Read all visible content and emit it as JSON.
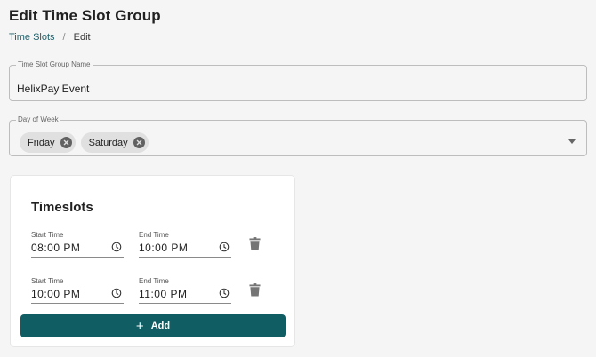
{
  "page": {
    "title": "Edit Time Slot Group"
  },
  "breadcrumb": {
    "link": "Time Slots",
    "separator": "/",
    "current": "Edit"
  },
  "group_name": {
    "label": "Time Slot Group Name",
    "value": "HelixPay Event"
  },
  "day_of_week": {
    "label": "Day of Week",
    "chips": [
      "Friday",
      "Saturday"
    ]
  },
  "timeslots": {
    "title": "Timeslots",
    "rows": [
      {
        "start_label": "Start Time",
        "start": "08:00 PM",
        "end_label": "End Time",
        "end": "10:00 PM"
      },
      {
        "start_label": "Start Time",
        "start": "10:00 PM",
        "end_label": "End Time",
        "end": "11:00 PM"
      }
    ],
    "add_label": "Add"
  },
  "colors": {
    "accent": "#105e63",
    "link": "#1e5f69",
    "chip": "#e0e0e0"
  }
}
